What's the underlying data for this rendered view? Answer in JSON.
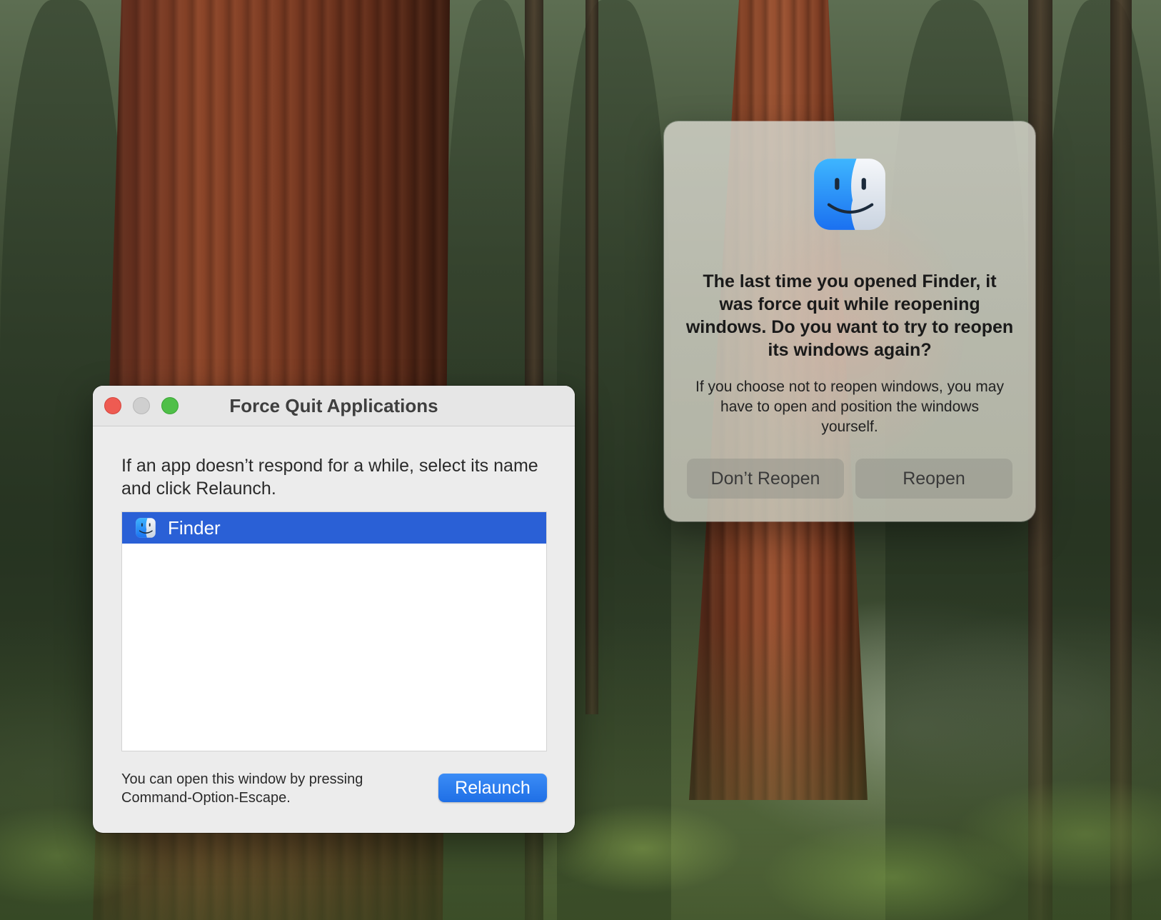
{
  "force_quit": {
    "title": "Force Quit Applications",
    "instructions": "If an app doesn’t respond for a while, select its name and click Relaunch.",
    "apps": [
      {
        "name": "Finder",
        "icon": "finder-icon",
        "selected": true
      }
    ],
    "footnote": "You can open this window by pressing Command-Option-Escape.",
    "relaunch_label": "Relaunch"
  },
  "alert": {
    "icon": "finder-icon",
    "title": "The last time you opened Finder, it was force quit while reopening windows. Do you want to try to reopen its windows again?",
    "message": "If you choose not to reopen windows, you may have to open and position the windows yourself.",
    "dont_reopen_label": "Don’t Reopen",
    "reopen_label": "Reopen"
  },
  "colors": {
    "selection": "#2a60d6",
    "primary_button": "#1f6fe6",
    "close": "#ee5b52",
    "zoom": "#4fbf48"
  }
}
